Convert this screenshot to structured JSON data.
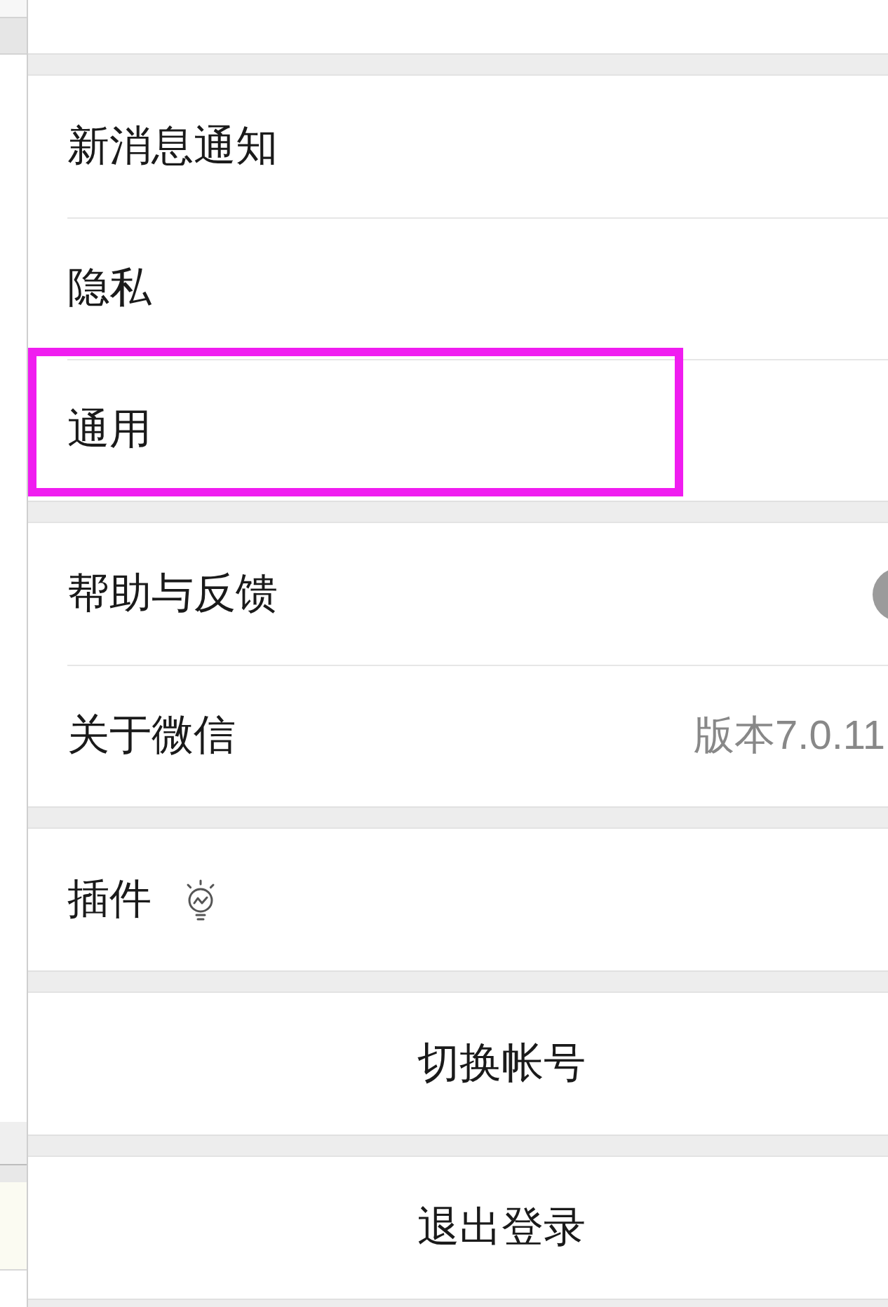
{
  "groups": [
    {
      "items": [
        {
          "kind": "link",
          "label": "新消息通知",
          "badge": false,
          "highlighted": false
        },
        {
          "kind": "link",
          "label": "隐私",
          "badge": false,
          "highlighted": false
        },
        {
          "kind": "link",
          "label": "通用",
          "badge": false,
          "highlighted": true
        }
      ]
    },
    {
      "items": [
        {
          "kind": "link",
          "label": "帮助与反馈",
          "badge": true,
          "highlighted": false
        },
        {
          "kind": "link",
          "label": "关于微信",
          "value": "版本7.0.11",
          "badge": false,
          "highlighted": false
        }
      ]
    },
    {
      "items": [
        {
          "kind": "link_icon",
          "label": "插件",
          "badge": false,
          "highlighted": false
        }
      ]
    },
    {
      "items": [
        {
          "kind": "action",
          "label": "切换帐号",
          "badge": false,
          "highlighted": false
        }
      ]
    },
    {
      "items": [
        {
          "kind": "action",
          "label": "退出登录",
          "badge": false,
          "highlighted": false
        }
      ]
    }
  ]
}
